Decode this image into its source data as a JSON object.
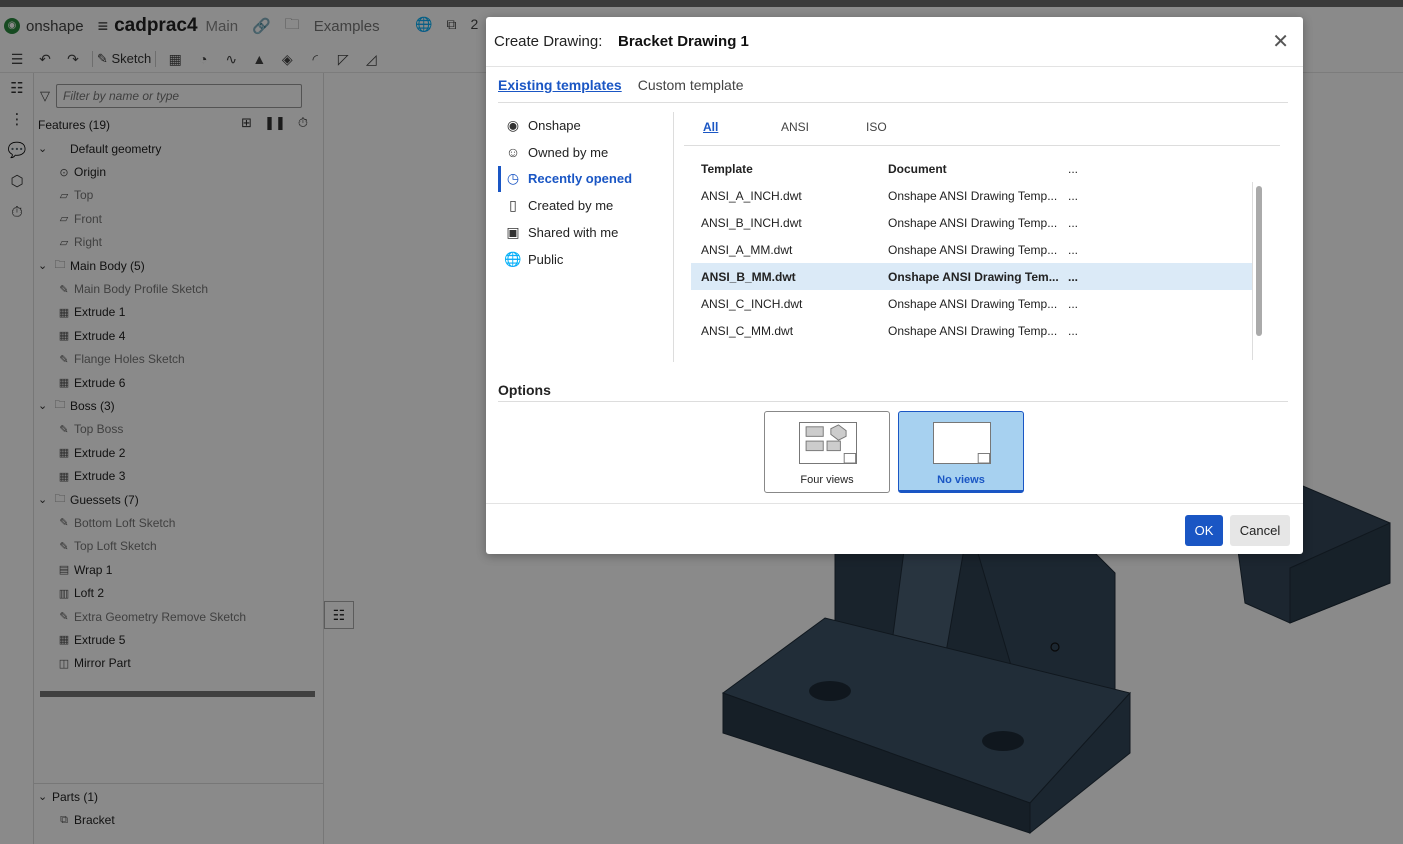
{
  "app": {
    "logo_text": "onshape",
    "document_name": "cadprac4",
    "workspace": "Main",
    "breadcrumb": "Examples",
    "tab_count": "2"
  },
  "toolbar": {
    "sketch_label": "Sketch"
  },
  "feature_tree": {
    "filter_placeholder": "Filter by name or type",
    "title": "Features (19)",
    "rows": [
      {
        "label": "Default geometry",
        "indent": 0,
        "chevron": "⌄",
        "icon": "",
        "grey": false
      },
      {
        "label": "Origin",
        "indent": 1,
        "chevron": "",
        "icon": "⊙",
        "grey": false
      },
      {
        "label": "Top",
        "indent": 1,
        "chevron": "",
        "icon": "▱",
        "grey": true
      },
      {
        "label": "Front",
        "indent": 1,
        "chevron": "",
        "icon": "▱",
        "grey": true
      },
      {
        "label": "Right",
        "indent": 1,
        "chevron": "",
        "icon": "▱",
        "grey": true
      },
      {
        "label": "Main Body (5)",
        "indent": 0,
        "chevron": "⌄",
        "icon": "🗀",
        "grey": false
      },
      {
        "label": "Main Body Profile Sketch",
        "indent": 1,
        "chevron": "",
        "icon": "✎",
        "grey": true
      },
      {
        "label": "Extrude 1",
        "indent": 1,
        "chevron": "",
        "icon": "▦",
        "grey": false
      },
      {
        "label": "Extrude 4",
        "indent": 1,
        "chevron": "",
        "icon": "▦",
        "grey": false
      },
      {
        "label": "Flange Holes Sketch",
        "indent": 1,
        "chevron": "",
        "icon": "✎",
        "grey": true
      },
      {
        "label": "Extrude 6",
        "indent": 1,
        "chevron": "",
        "icon": "▦",
        "grey": false
      },
      {
        "label": "Boss (3)",
        "indent": 0,
        "chevron": "⌄",
        "icon": "🗀",
        "grey": false
      },
      {
        "label": "Top Boss",
        "indent": 1,
        "chevron": "",
        "icon": "✎",
        "grey": true
      },
      {
        "label": "Extrude 2",
        "indent": 1,
        "chevron": "",
        "icon": "▦",
        "grey": false
      },
      {
        "label": "Extrude 3",
        "indent": 1,
        "chevron": "",
        "icon": "▦",
        "grey": false
      },
      {
        "label": "Guessets (7)",
        "indent": 0,
        "chevron": "⌄",
        "icon": "🗀",
        "grey": false
      },
      {
        "label": "Bottom Loft Sketch",
        "indent": 1,
        "chevron": "",
        "icon": "✎",
        "grey": true
      },
      {
        "label": "Top Loft Sketch",
        "indent": 1,
        "chevron": "",
        "icon": "✎",
        "grey": true
      },
      {
        "label": "Wrap 1",
        "indent": 1,
        "chevron": "",
        "icon": "▤",
        "grey": false
      },
      {
        "label": "Loft 2",
        "indent": 1,
        "chevron": "",
        "icon": "▥",
        "grey": false
      },
      {
        "label": "Extra Geometry Remove Sketch",
        "indent": 1,
        "chevron": "",
        "icon": "✎",
        "grey": true
      },
      {
        "label": "Extrude 5",
        "indent": 1,
        "chevron": "",
        "icon": "▦",
        "grey": false
      },
      {
        "label": "Mirror Part",
        "indent": 1,
        "chevron": "",
        "icon": "◫",
        "grey": false
      }
    ],
    "parts_title": "Parts (1)",
    "parts": [
      "Bracket"
    ]
  },
  "dialog": {
    "title_prefix": "Create Drawing:",
    "title_name": "Bracket Drawing 1",
    "tabs": [
      "Existing templates",
      "Custom template"
    ],
    "sources": [
      {
        "label": "Onshape",
        "icon": "onshape-logo-icon",
        "glyph": "◉"
      },
      {
        "label": "Owned by me",
        "icon": "user-icon",
        "glyph": "☺"
      },
      {
        "label": "Recently opened",
        "icon": "clock-icon",
        "glyph": "◷"
      },
      {
        "label": "Created by me",
        "icon": "document-icon",
        "glyph": "▯"
      },
      {
        "label": "Shared with me",
        "icon": "shared-user-icon",
        "glyph": "▣"
      },
      {
        "label": "Public",
        "icon": "globe-icon",
        "glyph": "🌐"
      }
    ],
    "active_source": "Recently opened",
    "standards": [
      "All",
      "ANSI",
      "ISO"
    ],
    "active_standard": "All",
    "table": {
      "headers": [
        "Template",
        "Document",
        "..."
      ],
      "rows": [
        [
          "ANSI_A_INCH.dwt",
          "Onshape ANSI Drawing Temp...",
          "..."
        ],
        [
          "ANSI_B_INCH.dwt",
          "Onshape ANSI Drawing Temp...",
          "..."
        ],
        [
          "ANSI_A_MM.dwt",
          "Onshape ANSI Drawing Temp...",
          "..."
        ],
        [
          "ANSI_B_MM.dwt",
          "Onshape ANSI Drawing Tem...",
          "..."
        ],
        [
          "ANSI_C_INCH.dwt",
          "Onshape ANSI Drawing Temp...",
          "..."
        ],
        [
          "ANSI_C_MM.dwt",
          "Onshape ANSI Drawing Temp...",
          "..."
        ]
      ],
      "selected_row": 3
    },
    "options_title": "Options",
    "options": [
      {
        "label": "Four views",
        "selected": false
      },
      {
        "label": "No views",
        "selected": true
      }
    ],
    "ok_label": "OK",
    "cancel_label": "Cancel"
  },
  "colors": {
    "accent": "#1a56c4",
    "selected_row": "#dbeaf7",
    "selected_card": "#a7d1f0",
    "part_fill": "#3d5063"
  }
}
